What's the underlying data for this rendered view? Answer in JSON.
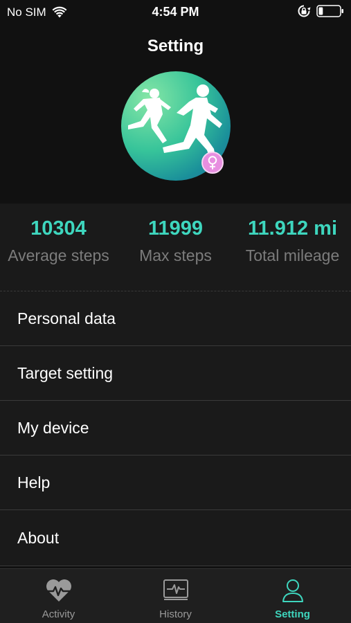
{
  "status_bar": {
    "carrier": "No SIM",
    "time": "4:54 PM",
    "wifi_icon": "wifi-icon",
    "rotation_lock_icon": "rotation-lock-icon",
    "battery_icon": "battery-icon",
    "battery_level": 0.2
  },
  "header": {
    "title": "Setting",
    "avatar_icon": "running-couple-avatar",
    "gender_icon": "female-symbol-icon",
    "gender_badge_color": "#e78ee0"
  },
  "stats": [
    {
      "value": "10304",
      "label": "Average steps"
    },
    {
      "value": "11999",
      "label": "Max steps"
    },
    {
      "value": "11.912 mi",
      "label": "Total mileage"
    }
  ],
  "menu": {
    "items": [
      {
        "label": "Personal data"
      },
      {
        "label": "Target setting"
      },
      {
        "label": "My device"
      },
      {
        "label": "Help"
      },
      {
        "label": "About"
      }
    ]
  },
  "tabs": [
    {
      "label": "Activity",
      "icon": "heart-pulse-icon",
      "active": false
    },
    {
      "label": "History",
      "icon": "monitor-pulse-icon",
      "active": false
    },
    {
      "label": "Setting",
      "icon": "user-icon",
      "active": true
    }
  ],
  "colors": {
    "accent": "#3ed6be",
    "background": "#111111",
    "panel": "#1a1a1a",
    "muted_text": "#7c7c7c"
  }
}
